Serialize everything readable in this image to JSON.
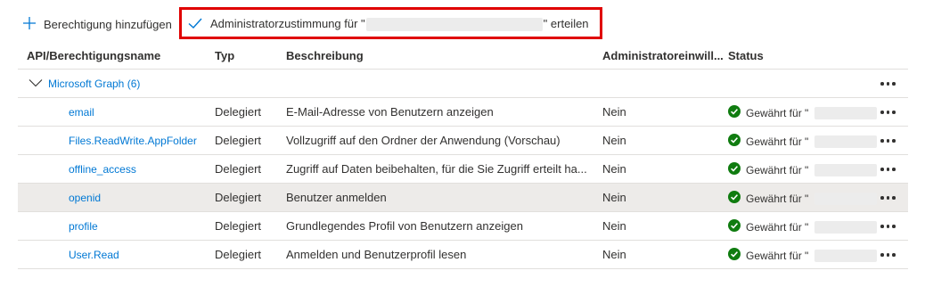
{
  "toolbar": {
    "add_label": "Berechtigung hinzufügen",
    "consent_prefix": "Administratorzustimmung für \"",
    "consent_suffix": "\" erteilen"
  },
  "table": {
    "headers": {
      "name": "API/Berechtigungsname",
      "type": "Typ",
      "description": "Beschreibung",
      "admin": "Administratoreinwill...",
      "status": "Status"
    },
    "group": {
      "label": "Microsoft Graph (6)"
    },
    "rows": [
      {
        "name": "email",
        "type": "Delegiert",
        "description": "E-Mail-Adresse von Benutzern anzeigen",
        "admin": "Nein",
        "status": "Gewährt für \""
      },
      {
        "name": "Files.ReadWrite.AppFolder",
        "type": "Delegiert",
        "description": "Vollzugriff auf den Ordner der Anwendung (Vorschau)",
        "admin": "Nein",
        "status": "Gewährt für \""
      },
      {
        "name": "offline_access",
        "type": "Delegiert",
        "description": "Zugriff auf Daten beibehalten, für die Sie Zugriff erteilt ha...",
        "admin": "Nein",
        "status": "Gewährt für \""
      },
      {
        "name": "openid",
        "type": "Delegiert",
        "description": "Benutzer anmelden",
        "admin": "Nein",
        "status": "Gewährt für \""
      },
      {
        "name": "profile",
        "type": "Delegiert",
        "description": "Grundlegendes Profil von Benutzern anzeigen",
        "admin": "Nein",
        "status": "Gewährt für \""
      },
      {
        "name": "User.Read",
        "type": "Delegiert",
        "description": "Anmelden und Benutzerprofil lesen",
        "admin": "Nein",
        "status": "Gewährt für \""
      }
    ]
  },
  "colors": {
    "accent": "#0078d4",
    "success": "#107c10",
    "highlight_border": "#e00000",
    "selected_row": "#edebe9"
  },
  "icons": {
    "add": "plus-icon",
    "consent": "checkmark-icon",
    "group": "chevron-down-icon",
    "status": "success-check-icon",
    "more": "more-icon"
  }
}
